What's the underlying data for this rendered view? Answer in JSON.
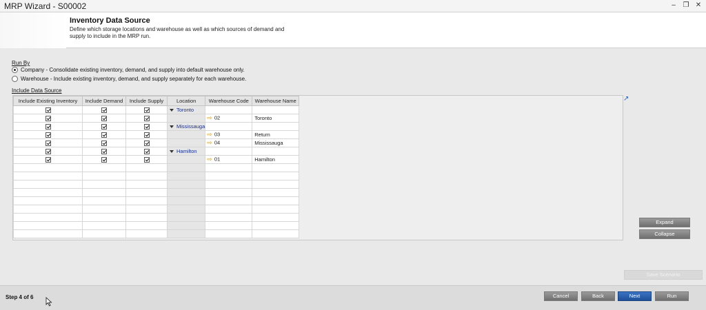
{
  "window": {
    "title": "MRP Wizard - S00002",
    "controls": [
      "minimize",
      "restore",
      "close"
    ]
  },
  "header": {
    "title": "Inventory Data Source",
    "description": "Define which storage locations and warehouse as well as which sources of demand and supply to include in the MRP run."
  },
  "run_by": {
    "label": "Run By",
    "options": [
      {
        "label": "Company - Consolidate existing inventory, demand, and supply into default warehouse only.",
        "selected": true
      },
      {
        "label": "Warehouse - Include existing inventory, demand, and supply separately for each warehouse.",
        "selected": false
      }
    ]
  },
  "data_source": {
    "label": "Include Data Source",
    "columns": [
      "Include Existing Inventory",
      "Include Demand",
      "Include Supply",
      "Location",
      "Warehouse Code",
      "Warehouse Name"
    ],
    "rows": [
      {
        "inventory": true,
        "demand": true,
        "supply": true,
        "location": "Toronto",
        "warehouse_code": "",
        "warehouse_name": ""
      },
      {
        "inventory": true,
        "demand": true,
        "supply": true,
        "location": "",
        "warehouse_code": "02",
        "warehouse_name": "Toronto"
      },
      {
        "inventory": true,
        "demand": true,
        "supply": true,
        "location": "Mississauga",
        "warehouse_code": "",
        "warehouse_name": ""
      },
      {
        "inventory": true,
        "demand": true,
        "supply": true,
        "location": "",
        "warehouse_code": "03",
        "warehouse_name": "Return"
      },
      {
        "inventory": true,
        "demand": true,
        "supply": true,
        "location": "",
        "warehouse_code": "04",
        "warehouse_name": "Mississauga"
      },
      {
        "inventory": true,
        "demand": true,
        "supply": true,
        "location": "Hamilton",
        "warehouse_code": "",
        "warehouse_name": ""
      },
      {
        "inventory": true,
        "demand": true,
        "supply": true,
        "location": "",
        "warehouse_code": "01",
        "warehouse_name": "Hamilton"
      }
    ],
    "empty_rows": 9
  },
  "side_buttons": {
    "expand": "Expand",
    "collapse": "Collapse",
    "save_scenario": "Save Scenario"
  },
  "footer": {
    "step": "Step 4 of 6",
    "cancel": "Cancel",
    "back": "Back",
    "next": "Next",
    "run": "Run"
  },
  "colors": {
    "primary_button": "#2a60b0",
    "secondary_button": "#808080",
    "location_text": "#1a2f8a",
    "link_arrow": "#d99a00"
  }
}
